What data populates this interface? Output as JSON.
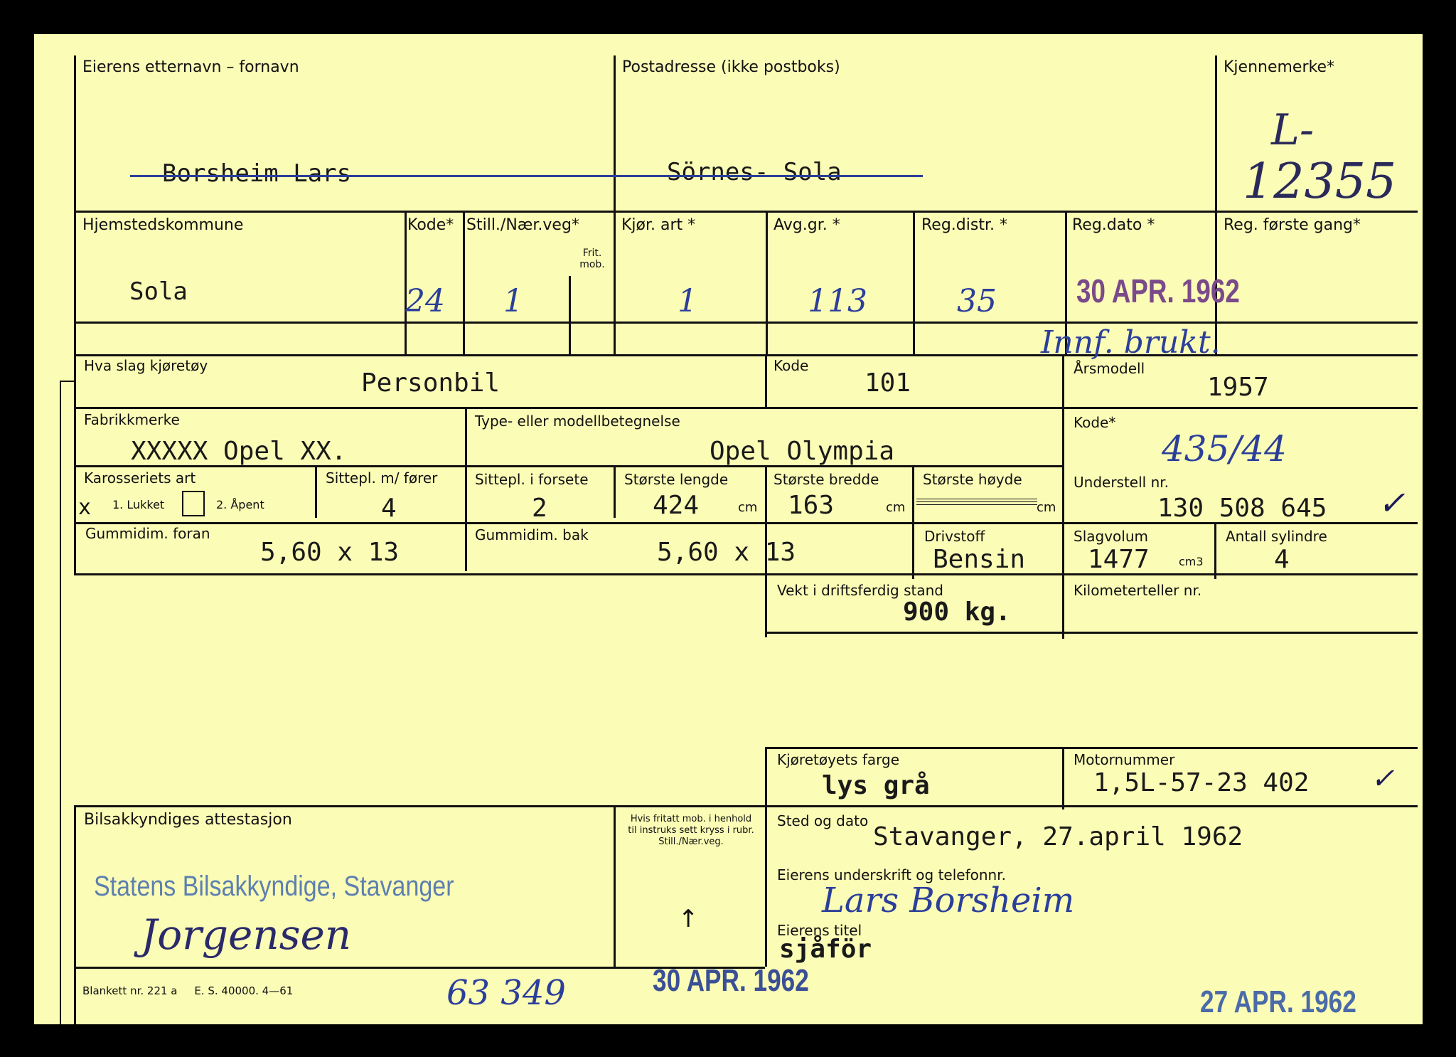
{
  "labels": {
    "owner_name": "Eierens etternavn – fornavn",
    "address": "Postadresse (ikke postboks)",
    "reg_mark": "Kjennemerke*",
    "municipality": "Hjemstedskommune",
    "kode": "Kode*",
    "still": "Still./Nær.veg*",
    "frit_mob": "Frit. mob.",
    "kjor_art": "Kjør. art *",
    "avg_gr": "Avg.gr. *",
    "reg_distr": "Reg.distr. *",
    "reg_dato": "Reg.dato *",
    "reg_forste": "Reg. første gang*",
    "vehicle_type": "Hva slag kjøretøy",
    "kode_plain": "Kode",
    "arsmodell": "Årsmodell",
    "make": "Fabrikkmerke",
    "model": "Type- eller modellbetegnelse",
    "kode2": "Kode*",
    "body": "Karosseriets art",
    "closed": "1. Lukket",
    "open": "2. Åpent",
    "seats_driver": "Sittepl. m/ fører",
    "seats_front": "Sittepl. i forsete",
    "length": "Største lengde",
    "width": "Største bredde",
    "height": "Største høyde",
    "cm": "cm",
    "chassis": "Understell nr.",
    "tyres_front": "Gummidim. foran",
    "tyres_rear": "Gummidim. bak",
    "fuel": "Drivstoff",
    "volume": "Slagvolum",
    "cm3": "cm3",
    "cylinders": "Antall sylindre",
    "weight": "Vekt i driftsferdig stand",
    "odometer": "Kilometerteller nr.",
    "colour": "Kjøretøyets farge",
    "engine_no": "Motornummer",
    "attest": "Bilsakkyndiges attestasjon",
    "exempt_note": "Hvis fritatt mob. i henhold til instruks sett kryss i rubr. Still./Nær.veg.",
    "place_date": "Sted og dato",
    "signature": "Eierens underskrift og telefonnr.",
    "title": "Eierens titel",
    "form_no": "Blankett nr. 221 a     E. S. 40000. 4—61"
  },
  "values": {
    "owner_name": "Borsheim Lars",
    "address": "Sörnes- Sola",
    "reg_mark_1": "L-",
    "reg_mark_2": "12355",
    "municipality": "Sola",
    "kode": "24",
    "still": "1",
    "kjor_art": "1",
    "avg_gr": "113",
    "reg_distr": "35",
    "reg_dato": "30 APR. 1962",
    "note": "Innf. brukt.",
    "vehicle_type": "Personbil",
    "vehicle_kode": "101",
    "arsmodell": "1957",
    "make": "XXXXX Opel XX.",
    "model": "Opel Olympia",
    "kode2": "435/44",
    "body_mark": "x",
    "seats_driver": "4",
    "seats_front": "2",
    "length": "424",
    "width": "163",
    "chassis": "130 508 645",
    "check": "✓",
    "tyres_front": "5,60 x 13",
    "tyres_rear": "5,60 x 13",
    "fuel": "Bensin",
    "volume": "1477",
    "cylinders": "4",
    "weight": "900 kg.",
    "colour": "lys grå",
    "engine_no": "1,5L-57-23 402",
    "attest_stamp": "Statens Bilsakkyndige, Stavanger",
    "attest_sign": "Jorgensen",
    "arrow": "↑",
    "place_date": "Stavanger, 27.april 1962",
    "signature": "Lars Borsheim",
    "title": "sjåför",
    "bottom_number": "63 349",
    "bottom_stamp1": "30 APR. 1962",
    "bottom_stamp2": "27 APR. 1962"
  }
}
